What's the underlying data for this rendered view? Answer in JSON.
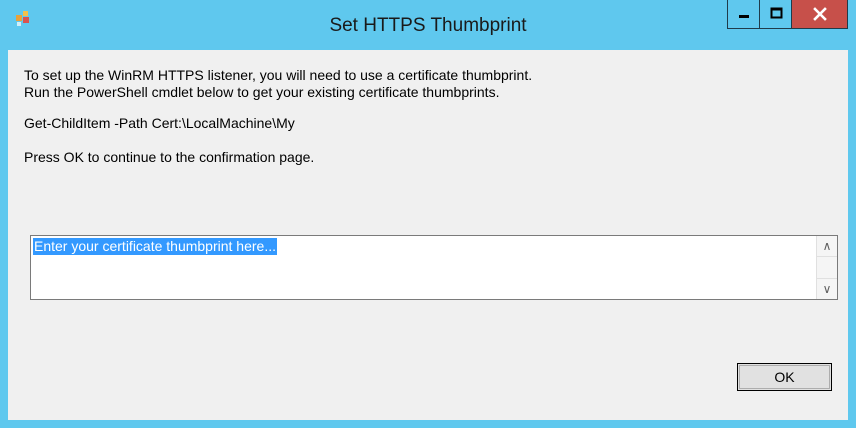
{
  "window": {
    "title": "Set HTTPS Thumbprint",
    "accent_color": "#5fc8ee",
    "close_color": "#c7504a",
    "controls": {
      "minimize_icon": "minimize-icon",
      "maximize_icon": "maximize-icon",
      "close_icon": "close-icon"
    }
  },
  "body": {
    "instruction_line1": "To set up the WinRM HTTPS listener, you will need to use a certificate thumbprint.",
    "instruction_line2": "Run the PowerShell cmdlet below to get your existing certificate thumbprints.",
    "command": "Get-ChildItem -Path Cert:\\LocalMachine\\My",
    "continue_text": "Press OK to continue to the confirmation page."
  },
  "thumbprint_input": {
    "value": "Enter your certificate thumbprint here...",
    "scroll_up_glyph": "∧",
    "scroll_down_glyph": "∨"
  },
  "buttons": {
    "ok_label": "OK"
  }
}
